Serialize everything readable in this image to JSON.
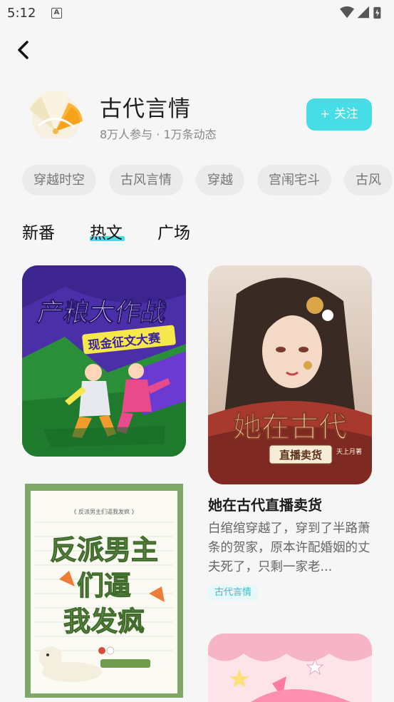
{
  "status_bar": {
    "time": "5:12",
    "notification_glyph": "A"
  },
  "header": {
    "title": "古代言情",
    "stats": "8万人参与 · 1万条动态",
    "follow_label": "+ 关注"
  },
  "chips": [
    "穿越时空",
    "古风言情",
    "穿越",
    "宫闱宅斗",
    "古风"
  ],
  "tabs": [
    "新番",
    "热文",
    "广场"
  ],
  "active_tab": "热文",
  "accent_color": "#47dde6",
  "cards": {
    "left_top": {
      "title_art": "产粮大作战",
      "subtitle_art": "现金征文大赛"
    },
    "left_bottom": {
      "art_line1": "反派男主",
      "art_line2": "们逼",
      "art_line3": "我发疯",
      "caption": "《 反派男主们逼我发疯 》"
    },
    "right_top": {
      "cover_title": "她在古代",
      "cover_subtitle": "直播卖货",
      "cover_author": "天上月著",
      "title": "她在古代直播卖货",
      "description": "白绾绾穿越了，穿到了半路萧条的贺家，原本许配婚姻的丈夫死了，只剩一家老...",
      "tag": "古代言情"
    }
  }
}
